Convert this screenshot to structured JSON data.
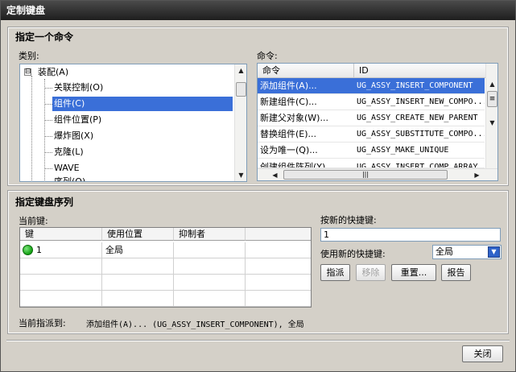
{
  "window": {
    "title": "定制键盘"
  },
  "command_group": {
    "title": "指定一个命令",
    "category_label": "类别:",
    "command_label": "命令:",
    "categories": [
      {
        "label": "装配(A)",
        "level": 0,
        "expander": "⊟"
      },
      {
        "label": "关联控制(O)",
        "level": 1
      },
      {
        "label": "组件(C)",
        "level": 1,
        "selected": true
      },
      {
        "label": "组件位置(P)",
        "level": 1
      },
      {
        "label": "爆炸图(X)",
        "level": 1
      },
      {
        "label": "克隆(L)",
        "level": 1
      },
      {
        "label": "WAVE",
        "level": 1
      },
      {
        "label": "序列(Q)",
        "level": 1
      }
    ],
    "command_columns": [
      "命令",
      "ID"
    ],
    "commands": [
      {
        "name": "添加组件(A)...",
        "id": "UG_ASSY_INSERT_COMPONENT",
        "selected": true
      },
      {
        "name": "新建组件(C)...",
        "id": "UG_ASSY_INSERT_NEW_COMPO..."
      },
      {
        "name": "新建父对象(W)...",
        "id": "UG_ASSY_CREATE_NEW_PARENT"
      },
      {
        "name": "替换组件(E)...",
        "id": "UG_ASSY_SUBSTITUTE_COMPO..."
      },
      {
        "name": "设为唯一(Q)...",
        "id": "UG_ASSY_MAKE_UNIQUE"
      },
      {
        "name": "创建组件阵列(Y)...",
        "id": "UG_ASSY_INSERT_COMP_ARRAY"
      }
    ],
    "hscroll_thumb_glyph": "|||",
    "vscroll_thumb_glyph": "≡"
  },
  "keyboard_group": {
    "title": "指定键盘序列",
    "current_keys_label": "当前键:",
    "columns": [
      "键",
      "使用位置",
      "抑制者"
    ],
    "rows": [
      {
        "key": "1",
        "location": "全局",
        "suppressed_by": "",
        "status_color": "#1aa81a"
      }
    ],
    "press_new_label": "按新的快捷键:",
    "new_shortcut_value": "1",
    "use_new_label": "使用新的快捷键:",
    "use_new_selected": "全局",
    "assign_button": "指派",
    "remove_button": "移除",
    "reset_button": "重置...",
    "report_button": "报告",
    "assigned_to_label": "当前指派到:",
    "assigned_to_value": "添加组件(A)... (UG_ASSY_INSERT_COMPONENT), 全局"
  },
  "footer": {
    "close_button": "关闭"
  },
  "colors": {
    "selection": "#3a6fd8",
    "dialog_bg": "#d4d0c8",
    "titlebar": "#2a2a2a"
  }
}
